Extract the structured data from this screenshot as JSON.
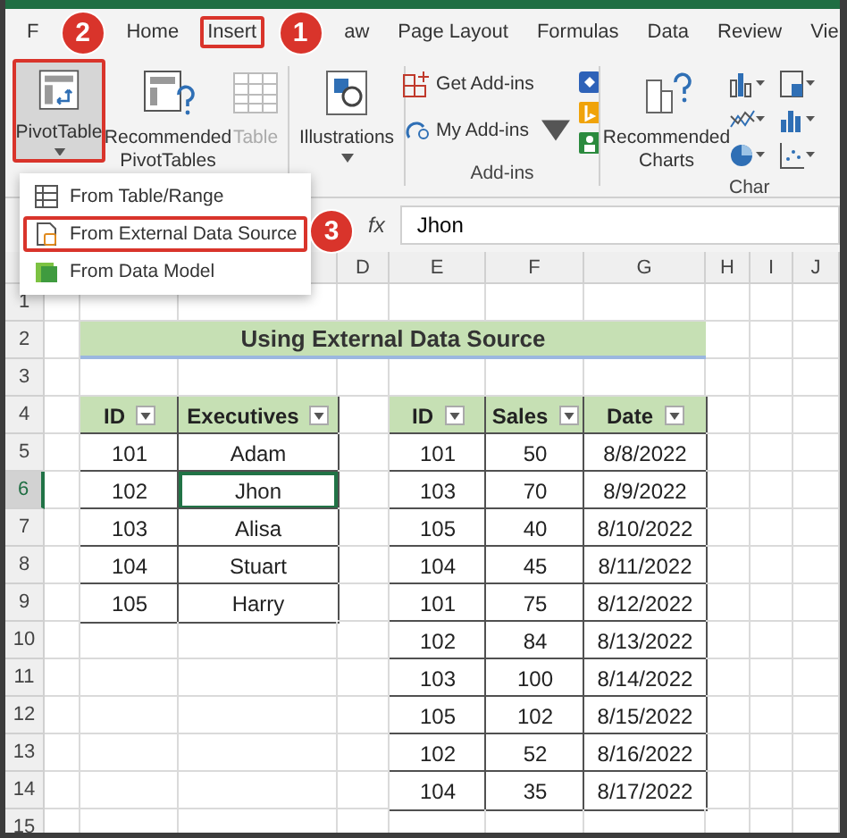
{
  "ribbon_tabs": [
    {
      "label": "F",
      "highlighted": false
    },
    {
      "label": "Home",
      "highlighted": false
    },
    {
      "label": "Insert",
      "highlighted": true
    },
    {
      "label": "aw",
      "highlighted": false
    },
    {
      "label": "Page Layout",
      "highlighted": false
    },
    {
      "label": "Formulas",
      "highlighted": false
    },
    {
      "label": "Data",
      "highlighted": false
    },
    {
      "label": "Review",
      "highlighted": false
    },
    {
      "label": "Vie",
      "highlighted": false
    }
  ],
  "ribbon_groups": [
    {
      "kind": "tables",
      "items": [
        {
          "label": "PivotTable",
          "dropdown": true,
          "highlighted": true,
          "disabled": false
        },
        {
          "label": "Recommended PivotTables",
          "dropdown": false,
          "highlighted": false,
          "disabled": false
        },
        {
          "label": "Table",
          "dropdown": false,
          "highlighted": false,
          "disabled": true
        }
      ]
    },
    {
      "kind": "illustrations",
      "items": [
        {
          "label": "Illustrations",
          "dropdown": true
        }
      ]
    },
    {
      "kind": "addins",
      "label": "Add-ins",
      "items": [
        {
          "label": "Get Add-ins",
          "dropdown": false
        },
        {
          "label": "My Add-ins",
          "dropdown": true
        }
      ]
    },
    {
      "kind": "charts",
      "label": "Char",
      "items": [
        {
          "label": "Recommended Charts",
          "dropdown": false
        }
      ]
    }
  ],
  "dropdown_menu": [
    {
      "label": "From Table/Range",
      "highlighted": false
    },
    {
      "label": "From External Data Source",
      "highlighted": true
    },
    {
      "label": "From Data Model",
      "highlighted": false
    }
  ],
  "formula_bar": {
    "function_label": "fx",
    "value": "Jhon"
  },
  "column_headers": [
    "D",
    "E",
    "F",
    "G",
    "H",
    "I",
    "J"
  ],
  "row_headers": [
    "1",
    "2",
    "3",
    "4",
    "5",
    "6",
    "7",
    "8",
    "9",
    "10",
    "11",
    "12",
    "13",
    "14",
    "15"
  ],
  "sheet": {
    "title": "Using External Data Source",
    "table_1": {
      "columns": [
        "ID",
        "Executives"
      ],
      "rows": [
        [
          {
            "text": "101",
            "selected": false
          },
          {
            "text": "Adam",
            "selected": false
          }
        ],
        [
          {
            "text": "102",
            "selected": false
          },
          {
            "text": "Jhon",
            "selected": true
          }
        ],
        [
          {
            "text": "103",
            "selected": false
          },
          {
            "text": "Alisa",
            "selected": false
          }
        ],
        [
          {
            "text": "104",
            "selected": false
          },
          {
            "text": "Stuart",
            "selected": false
          }
        ],
        [
          {
            "text": "105",
            "selected": false
          },
          {
            "text": "Harry",
            "selected": false
          }
        ]
      ]
    },
    "table_2": {
      "columns": [
        "ID",
        "Sales",
        "Date"
      ],
      "rows": [
        [
          "101",
          "50",
          "8/8/2022"
        ],
        [
          "103",
          "70",
          "8/9/2022"
        ],
        [
          "105",
          "40",
          "8/10/2022"
        ],
        [
          "104",
          "45",
          "8/11/2022"
        ],
        [
          "101",
          "75",
          "8/12/2022"
        ],
        [
          "102",
          "84",
          "8/13/2022"
        ],
        [
          "103",
          "100",
          "8/14/2022"
        ],
        [
          "105",
          "102",
          "8/15/2022"
        ],
        [
          "102",
          "52",
          "8/16/2022"
        ],
        [
          "104",
          "35",
          "8/17/2022"
        ]
      ]
    }
  },
  "step_badges": [
    "2",
    "1",
    "3"
  ]
}
